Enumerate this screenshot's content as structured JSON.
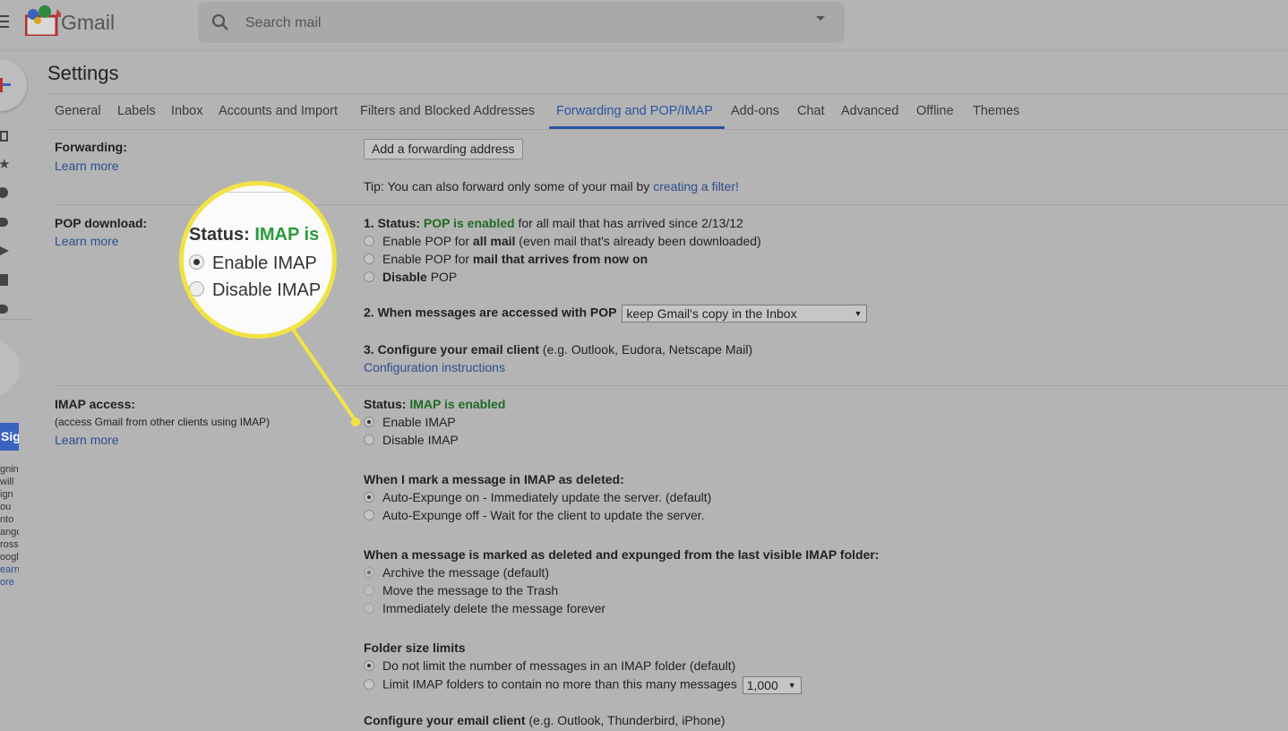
{
  "header": {
    "app_name": "Gmail",
    "search_placeholder": "Search mail"
  },
  "page_title": "Settings",
  "tabs": [
    {
      "label": "General"
    },
    {
      "label": "Labels"
    },
    {
      "label": "Inbox"
    },
    {
      "label": "Accounts and Import"
    },
    {
      "label": "Filters and Blocked Addresses"
    },
    {
      "label": "Forwarding and POP/IMAP",
      "active": true
    },
    {
      "label": "Add-ons"
    },
    {
      "label": "Chat"
    },
    {
      "label": "Advanced"
    },
    {
      "label": "Offline"
    },
    {
      "label": "Themes"
    }
  ],
  "learn_more": "Learn more",
  "forwarding": {
    "label": "Forwarding:",
    "button": "Add a forwarding address",
    "tip": "Tip: You can also forward only some of your mail by ",
    "tip_link": "creating a filter!"
  },
  "pop": {
    "label": "POP download:",
    "status_prefix": "1. Status: ",
    "status": "POP is enabled",
    "status_suffix": " for all mail that has arrived since 2/13/12",
    "opt1_a": "Enable POP for ",
    "opt1_b": "all mail",
    "opt1_c": " (even mail that's already been downloaded)",
    "opt2_a": "Enable POP for ",
    "opt2_b": "mail that arrives from now on",
    "opt3_a": "Disable",
    "opt3_b": " POP",
    "q2": "2. When messages are accessed with POP",
    "q2_value": "keep Gmail's copy in the Inbox",
    "q3": "3. Configure your email client",
    "q3_hint": " (e.g. Outlook, Eudora, Netscape Mail)",
    "q3_link": "Configuration instructions"
  },
  "imap": {
    "label": "IMAP access:",
    "sub": "(access Gmail from other clients using IMAP)",
    "status_prefix": "Status: ",
    "status": "IMAP is enabled",
    "status_zoom": "IMAP is",
    "enable": "Enable IMAP",
    "disable": "Disable IMAP",
    "deleted_q": "When I mark a message in IMAP as deleted:",
    "del1": "Auto-Expunge on - Immediately update the server. (default)",
    "del2": "Auto-Expunge off - Wait for the client to update the server.",
    "expunged_q": "When a message is marked as deleted and expunged from the last visible IMAP folder:",
    "exp1": "Archive the message (default)",
    "exp2": "Move the message to the Trash",
    "exp3": "Immediately delete the message forever",
    "folder_q": "Folder size limits",
    "fold1": "Do not limit the number of messages in an IMAP folder (default)",
    "fold2": "Limit IMAP folders to contain no more than this many messages",
    "fold_value": "1,000",
    "client_q": "Configure your email client",
    "client_hint": " (e.g. Outlook, Thunderbird, iPhone)"
  },
  "sidebar_fragment": {
    "button": "Sig",
    "lines": [
      "gnin",
      "will",
      "ign",
      "ou",
      "nto",
      "angc",
      "ross",
      "oogl"
    ],
    "link1": "earn",
    "link2": "ore"
  },
  "colors": {
    "highlight": "#f2e245",
    "accent": "#2b55a0",
    "enabled": "#1f6b25"
  }
}
